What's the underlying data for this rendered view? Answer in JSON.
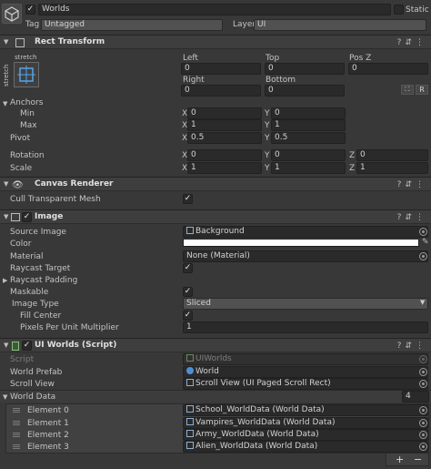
{
  "header": {
    "object_name": "Worlds",
    "static_label": "Static",
    "tag_label": "Tag",
    "tag_value": "Untagged",
    "layer_label": "Layer",
    "layer_value": "UI"
  },
  "rect_transform": {
    "title": "Rect Transform",
    "anchor_preset_top": "stretch",
    "anchor_preset_side": "stretch",
    "left_label": "Left",
    "left": "0",
    "top_label": "Top",
    "top": "0",
    "posz_label": "Pos Z",
    "posz": "0",
    "right_label": "Right",
    "right": "0",
    "bottom_label": "Bottom",
    "bottom": "0",
    "blueprint_btn": "R",
    "anchors_label": "Anchors",
    "min_label": "Min",
    "min_x": "0",
    "min_y": "0",
    "max_label": "Max",
    "max_x": "1",
    "max_y": "1",
    "pivot_label": "Pivot",
    "pivot_x": "0.5",
    "pivot_y": "0.5",
    "rotation_label": "Rotation",
    "rot_x": "0",
    "rot_y": "0",
    "rot_z": "0",
    "scale_label": "Scale",
    "scale_x": "1",
    "scale_y": "1",
    "scale_z": "1",
    "x": "X",
    "y": "Y",
    "z": "Z"
  },
  "canvas_renderer": {
    "title": "Canvas Renderer",
    "cull_label": "Cull Transparent Mesh"
  },
  "image": {
    "title": "Image",
    "source_label": "Source Image",
    "source_value": "Background",
    "color_label": "Color",
    "color_value": "#ffffff",
    "material_label": "Material",
    "material_value": "None (Material)",
    "raycast_label": "Raycast Target",
    "raycast_padding_label": "Raycast Padding",
    "maskable_label": "Maskable",
    "type_label": "Image Type",
    "type_value": "Sliced",
    "fill_center_label": "Fill Center",
    "ppu_label": "Pixels Per Unit Multiplier",
    "ppu_value": "1"
  },
  "ui_worlds": {
    "title": "UI Worlds (Script)",
    "script_label": "Script",
    "script_value": "UIWorlds",
    "prefab_label": "World Prefab",
    "prefab_value": "World",
    "scroll_label": "Scroll View",
    "scroll_value": "Scroll View (UI Paged Scroll Rect)",
    "worlddata_label": "World Data",
    "worlddata_count": "4",
    "elements": [
      {
        "label": "Element 0",
        "value": "School_WorldData (World Data)"
      },
      {
        "label": "Element 1",
        "value": "Vampires_WorldData (World Data)"
      },
      {
        "label": "Element 2",
        "value": "Army_WorldData (World Data)"
      },
      {
        "label": "Element 3",
        "value": "Alien_WorldData (World Data)"
      }
    ],
    "add_btn": "+",
    "remove_btn": "−"
  }
}
